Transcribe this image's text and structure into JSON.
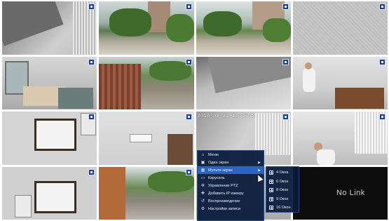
{
  "cameras": [
    {
      "id": 1,
      "scene": "ceiling-corner-blinds",
      "timestamp": ""
    },
    {
      "id": 2,
      "scene": "street-trees-building",
      "timestamp": ""
    },
    {
      "id": 3,
      "scene": "street-trees-building-2",
      "timestamp": ""
    },
    {
      "id": 4,
      "scene": "textured-wall",
      "timestamp": ""
    },
    {
      "id": 5,
      "scene": "office-room-chairs",
      "timestamp": ""
    },
    {
      "id": 6,
      "scene": "parking-fence",
      "timestamp": ""
    },
    {
      "id": 7,
      "scene": "ceiling-corner",
      "timestamp": ""
    },
    {
      "id": 8,
      "scene": "office-person-desk",
      "timestamp": ""
    },
    {
      "id": 9,
      "scene": "test-chart-wall",
      "timestamp": ""
    },
    {
      "id": 10,
      "scene": "ac-unit-room",
      "timestamp": ""
    },
    {
      "id": 11,
      "scene": "corner-window",
      "timestamp": "2016-08-24 12:13:55"
    },
    {
      "id": 12,
      "scene": "office-person-computer",
      "timestamp": ""
    },
    {
      "id": 13,
      "scene": "test-chart-wall-2",
      "timestamp": ""
    },
    {
      "id": 14,
      "scene": "street-trees-road",
      "timestamp": ""
    },
    {
      "id": 15,
      "scene": "menu-overlay",
      "timestamp": ""
    },
    {
      "id": 16,
      "scene": "no-link",
      "timestamp": ""
    }
  ],
  "no_link_text": "No Link",
  "context_menu": {
    "items": [
      {
        "icon": "home-icon",
        "label": "Меню",
        "has_submenu": false
      },
      {
        "icon": "camera-icon",
        "label": "Один экран",
        "has_submenu": true
      },
      {
        "icon": "grid-icon",
        "label": "Мульти-экран",
        "has_submenu": true,
        "active": true
      },
      {
        "icon": "monitor-icon",
        "label": "Карусель",
        "has_submenu": false
      },
      {
        "icon": "gear-icon",
        "label": "Управление PTZ",
        "has_submenu": false
      },
      {
        "icon": "plus-icon",
        "label": "Добавить IP камеру",
        "has_submenu": false
      },
      {
        "icon": "playback-icon",
        "label": "Воспроизведение",
        "has_submenu": false
      },
      {
        "icon": "settings-icon",
        "label": "Настройки записи",
        "has_submenu": false
      }
    ]
  },
  "submenu": {
    "items": [
      {
        "label": "4 Окна"
      },
      {
        "label": "6 Окон"
      },
      {
        "label": "8 Окон"
      },
      {
        "label": "9 Окон"
      },
      {
        "label": "16 Окон"
      }
    ]
  },
  "colors": {
    "menu_bg": "#0a1c3c",
    "menu_active": "#2c63c7",
    "badge": "#1b3f8f"
  }
}
